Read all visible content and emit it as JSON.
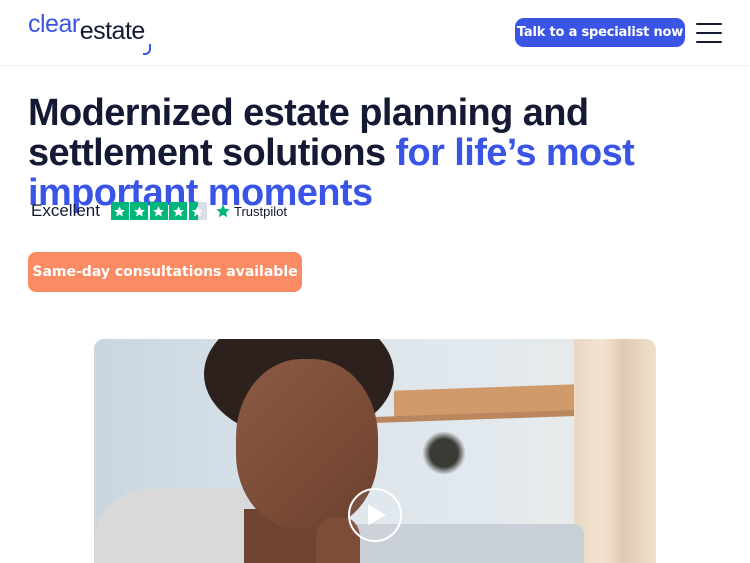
{
  "header": {
    "logo_part1": "clear",
    "logo_part2": "estate",
    "cta_label": "Talk to a specialist now",
    "menu_icon": "hamburger-menu-icon"
  },
  "hero": {
    "headline_main": "Modernized estate planning and settlement solutions ",
    "headline_accent": "for life’s most important moments",
    "rating_label": "Excellent",
    "rating_stars": 4.5,
    "rating_source": "Trustpilot",
    "consult_label": "Same-day consultations available"
  },
  "video": {
    "play_icon": "play-icon"
  },
  "colors": {
    "brand_blue": "#3a55e6",
    "accent_orange": "#fb8b62",
    "trustpilot_green": "#00b67a",
    "text_dark": "#141a33"
  }
}
